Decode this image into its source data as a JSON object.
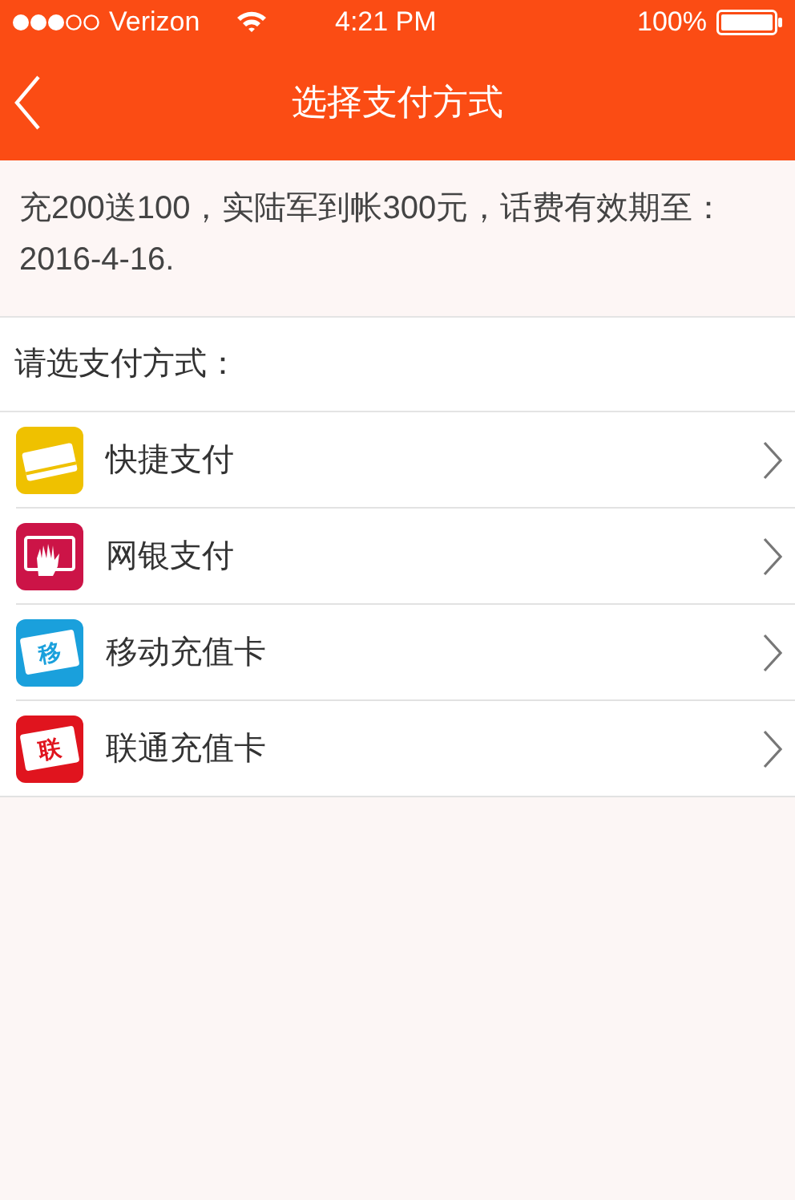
{
  "status_bar": {
    "carrier": "Verizon",
    "time": "4:21 PM",
    "battery": "100%"
  },
  "nav": {
    "title": "选择支付方式"
  },
  "notice": "充200送100，实陆军到帐300元，话费有效期至：2016-4-16.",
  "section_label": "请选支付方式：",
  "methods": [
    {
      "label": "快捷支付",
      "kind": "card",
      "color": "#efc100"
    },
    {
      "label": "网银支付",
      "kind": "bank",
      "color": "#cc1447"
    },
    {
      "label": "移动充值卡",
      "kind": "charcard",
      "color": "#1aa0dc",
      "icon_text": "移"
    },
    {
      "label": "联通充值卡",
      "kind": "charcard",
      "color": "#e0141e",
      "icon_text": "联"
    }
  ]
}
